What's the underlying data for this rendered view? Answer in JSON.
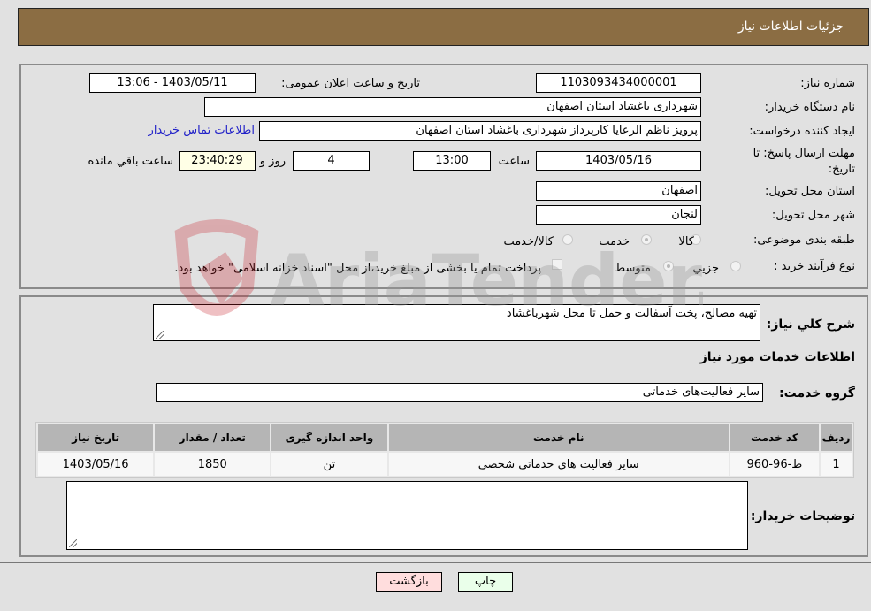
{
  "header": {
    "title": "جزئیات اطلاعات نیاز"
  },
  "fields": {
    "need_number": {
      "label": "شماره نیاز:",
      "value": "1103093434000001"
    },
    "announce_datetime": {
      "label": "تاریخ و ساعت اعلان عمومی:",
      "value": "1403/05/11 - 13:06"
    },
    "buyer_org": {
      "label": "نام دستگاه خریدار:",
      "value": "شهرداری باغشاد استان اصفهان"
    },
    "requester": {
      "label": "ایجاد کننده درخواست:",
      "value": "پرویز ناظم الرعایا کارپرداز شهرداری باغشاد استان اصفهان"
    },
    "contact_link": "اطلاعات تماس خریدار",
    "deadline": {
      "label": "مهلت ارسال پاسخ: تا تاریخ:",
      "date": "1403/05/16",
      "time_label": "ساعت",
      "time": "13:00",
      "days": "4",
      "days_label": "روز و",
      "remaining": "23:40:29",
      "remaining_label": "ساعت باقي مانده"
    },
    "delivery_province": {
      "label": "استان محل تحویل:",
      "value": "اصفهان"
    },
    "delivery_city": {
      "label": "شهر محل تحویل:",
      "value": "لنجان"
    },
    "category": {
      "label": "طبقه بندی موضوعی:",
      "options": [
        "کالا",
        "خدمت",
        "کالا/خدمت"
      ],
      "selected": "خدمت"
    },
    "purchase_type": {
      "label": "نوع فرآیند خرید :",
      "options": [
        "جزیي",
        "متوسط"
      ],
      "selected": "متوسط",
      "treasury_note": "پرداخت تمام یا بخشی از مبلغ خرید،از محل \"اسناد خزانه اسلامی\" خواهد بود.",
      "treasury_checked": false
    }
  },
  "details": {
    "description_label": "شرح کلي نیاز:",
    "description": "تهیه مصالح، پخت آسفالت و حمل تا محل شهرباغشاد",
    "services_heading": "اطلاعات خدمات مورد نیاز",
    "service_group_label": "گروه خدمت:",
    "service_group": "سایر فعالیت‌های خدماتی",
    "table": {
      "headers": [
        "ردیف",
        "کد خدمت",
        "نام خدمت",
        "واحد اندازه گیری",
        "تعداد / مقدار",
        "تاریخ نیاز"
      ],
      "rows": [
        [
          "1",
          "ط-96-960",
          "سایر فعالیت های خدماتی شخصی",
          "تن",
          "1850",
          "1403/05/16"
        ]
      ]
    },
    "buyer_notes_label": "توضیحات خریدار:",
    "buyer_notes": ""
  },
  "buttons": {
    "print": "چاپ",
    "back": "بازگشت"
  },
  "watermark": "AriaTender.neT",
  "colors": {
    "header": "#8b6d43",
    "print_bg": "#eaffea",
    "back_bg": "#ffdddd",
    "link": "#2020c8"
  }
}
